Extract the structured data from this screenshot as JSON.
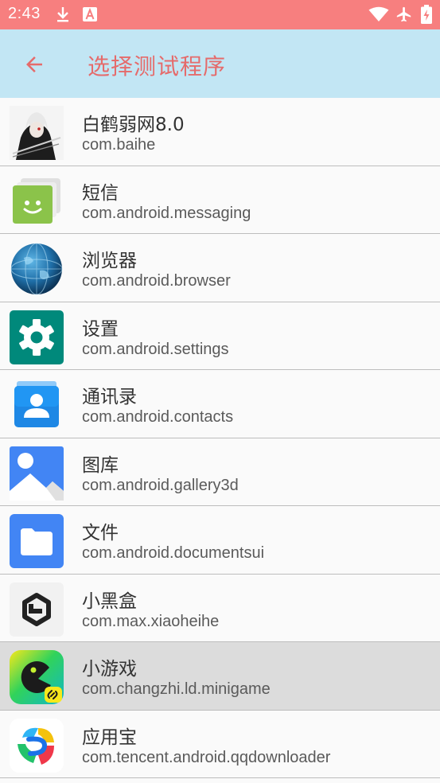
{
  "status_bar": {
    "time": "2:43",
    "icons": [
      "download-icon",
      "font-a-icon",
      "wifi-icon",
      "airplane-mode-icon",
      "battery-charging-icon"
    ],
    "color": "#f77f7f"
  },
  "app_bar": {
    "title": "选择测试程序",
    "back_icon": "arrow-back-icon",
    "background": "#c2e6f4",
    "title_color": "#e56b6b"
  },
  "apps": [
    {
      "name": "白鹤弱网8.0",
      "package": "com.baihe",
      "icon": "baihe-app-icon"
    },
    {
      "name": "短信",
      "package": "com.android.messaging",
      "icon": "messaging-app-icon"
    },
    {
      "name": "浏览器",
      "package": "com.android.browser",
      "icon": "browser-app-icon"
    },
    {
      "name": "设置",
      "package": "com.android.settings",
      "icon": "settings-app-icon"
    },
    {
      "name": "通讯录",
      "package": "com.android.contacts",
      "icon": "contacts-app-icon"
    },
    {
      "name": "图库",
      "package": "com.android.gallery3d",
      "icon": "gallery-app-icon"
    },
    {
      "name": "文件",
      "package": "com.android.documentsui",
      "icon": "files-app-icon"
    },
    {
      "name": "小黑盒",
      "package": "com.max.xiaoheihe",
      "icon": "xiaoheihe-app-icon"
    },
    {
      "name": "小游戏",
      "package": "com.changzhi.ld.minigame",
      "icon": "minigame-app-icon",
      "selected": true
    },
    {
      "name": "应用宝",
      "package": "com.tencent.android.qqdownloader",
      "icon": "yingyongbao-app-icon"
    }
  ]
}
